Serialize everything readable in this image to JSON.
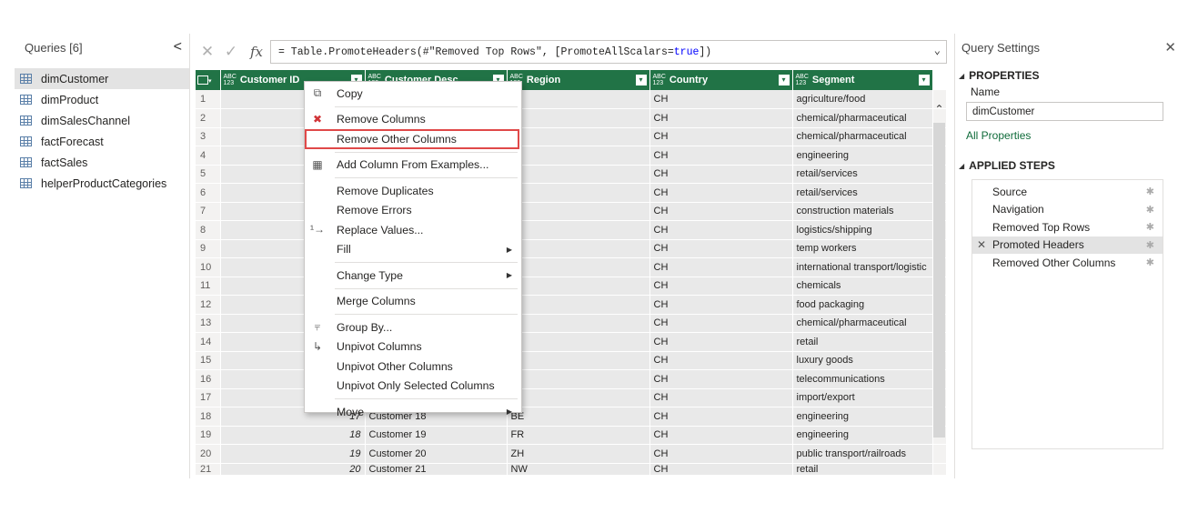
{
  "queries": {
    "title": "Queries [6]",
    "collapse_glyph": "<",
    "items": [
      {
        "label": "dimCustomer",
        "selected": true
      },
      {
        "label": "dimProduct",
        "selected": false
      },
      {
        "label": "dimSalesChannel",
        "selected": false
      },
      {
        "label": "factForecast",
        "selected": false
      },
      {
        "label": "factSales",
        "selected": false
      },
      {
        "label": "helperProductCategories",
        "selected": false
      }
    ]
  },
  "formula": {
    "cancel_glyph": "✕",
    "commit_glyph": "✓",
    "fx_label": "fx",
    "prefix": "= Table.PromoteHeaders(#\"Removed Top Rows\", [PromoteAllScalars=",
    "keyword": "true",
    "suffix": "])",
    "expand_glyph": "⌄"
  },
  "grid": {
    "type_label_top": "ABC",
    "type_label_bottom": "123",
    "columns": [
      "Customer ID",
      "Customer Desc",
      "Region",
      "Country",
      "Segment"
    ],
    "rows": [
      [
        "1",
        "",
        "",
        "",
        "CH",
        "agriculture/food"
      ],
      [
        "2",
        "",
        "",
        "",
        "CH",
        "chemical/pharmaceutical"
      ],
      [
        "3",
        "",
        "",
        "",
        "CH",
        "chemical/pharmaceutical"
      ],
      [
        "4",
        "",
        "",
        "",
        "CH",
        "engineering"
      ],
      [
        "5",
        "",
        "",
        "",
        "CH",
        "retail/services"
      ],
      [
        "6",
        "",
        "",
        "",
        "CH",
        "retail/services"
      ],
      [
        "7",
        "",
        "",
        "",
        "CH",
        "construction materials"
      ],
      [
        "8",
        "",
        "",
        "",
        "CH",
        "logistics/shipping"
      ],
      [
        "9",
        "",
        "",
        "",
        "CH",
        "temp workers"
      ],
      [
        "10",
        "",
        "",
        "",
        "CH",
        "international transport/logistic"
      ],
      [
        "11",
        "",
        "",
        "",
        "CH",
        "chemicals"
      ],
      [
        "12",
        "",
        "",
        "",
        "CH",
        "food packaging"
      ],
      [
        "13",
        "",
        "",
        "",
        "CH",
        "chemical/pharmaceutical"
      ],
      [
        "14",
        "",
        "",
        "",
        "CH",
        "retail"
      ],
      [
        "15",
        "",
        "",
        "",
        "CH",
        "luxury goods"
      ],
      [
        "16",
        "",
        "",
        "",
        "CH",
        "telecommunications"
      ],
      [
        "17",
        "",
        "",
        "",
        "CH",
        "import/export"
      ],
      [
        "18",
        "17",
        "Customer 18",
        "BE",
        "CH",
        "engineering"
      ],
      [
        "19",
        "18",
        "Customer 19",
        "FR",
        "CH",
        "engineering"
      ],
      [
        "20",
        "19",
        "Customer 20",
        "ZH",
        "CH",
        "public transport/railroads"
      ],
      [
        "21",
        "20",
        "Customer 21",
        "NW",
        "CH",
        "retail"
      ]
    ]
  },
  "context_menu": {
    "items": [
      {
        "label": "Copy",
        "icon": "copy-icon",
        "sep_after": true
      },
      {
        "label": "Remove Columns",
        "icon": "remove-columns-icon"
      },
      {
        "label": "Remove Other Columns",
        "highlighted": true,
        "sep_after": true
      },
      {
        "label": "Add Column From Examples...",
        "icon": "column-examples-icon",
        "sep_after": true
      },
      {
        "label": "Remove Duplicates"
      },
      {
        "label": "Remove Errors"
      },
      {
        "label": "Replace Values...",
        "icon": "replace-values-icon"
      },
      {
        "label": "Fill",
        "submenu": true,
        "sep_after": true
      },
      {
        "label": "Change Type",
        "submenu": true,
        "sep_after": true
      },
      {
        "label": "Merge Columns",
        "sep_after": true
      },
      {
        "label": "Group By...",
        "icon": "group-by-icon"
      },
      {
        "label": "Unpivot Columns",
        "icon": "unpivot-icon"
      },
      {
        "label": "Unpivot Other Columns"
      },
      {
        "label": "Unpivot Only Selected Columns",
        "sep_after": true
      },
      {
        "label": "Move",
        "submenu": true
      }
    ]
  },
  "settings": {
    "title": "Query Settings",
    "close_glyph": "✕",
    "properties_heading": "PROPERTIES",
    "name_label": "Name",
    "name_value": "dimCustomer",
    "all_properties_link": "All Properties",
    "applied_steps_heading": "APPLIED STEPS",
    "steps": [
      {
        "label": "Source",
        "selected": false
      },
      {
        "label": "Navigation",
        "selected": false
      },
      {
        "label": "Removed Top Rows",
        "selected": false
      },
      {
        "label": "Promoted Headers",
        "selected": true
      },
      {
        "label": "Removed Other Columns",
        "selected": false
      }
    ]
  },
  "colors": {
    "header_green": "#217346",
    "highlight_red": "#e04949",
    "link_green": "#0f6b3a"
  }
}
